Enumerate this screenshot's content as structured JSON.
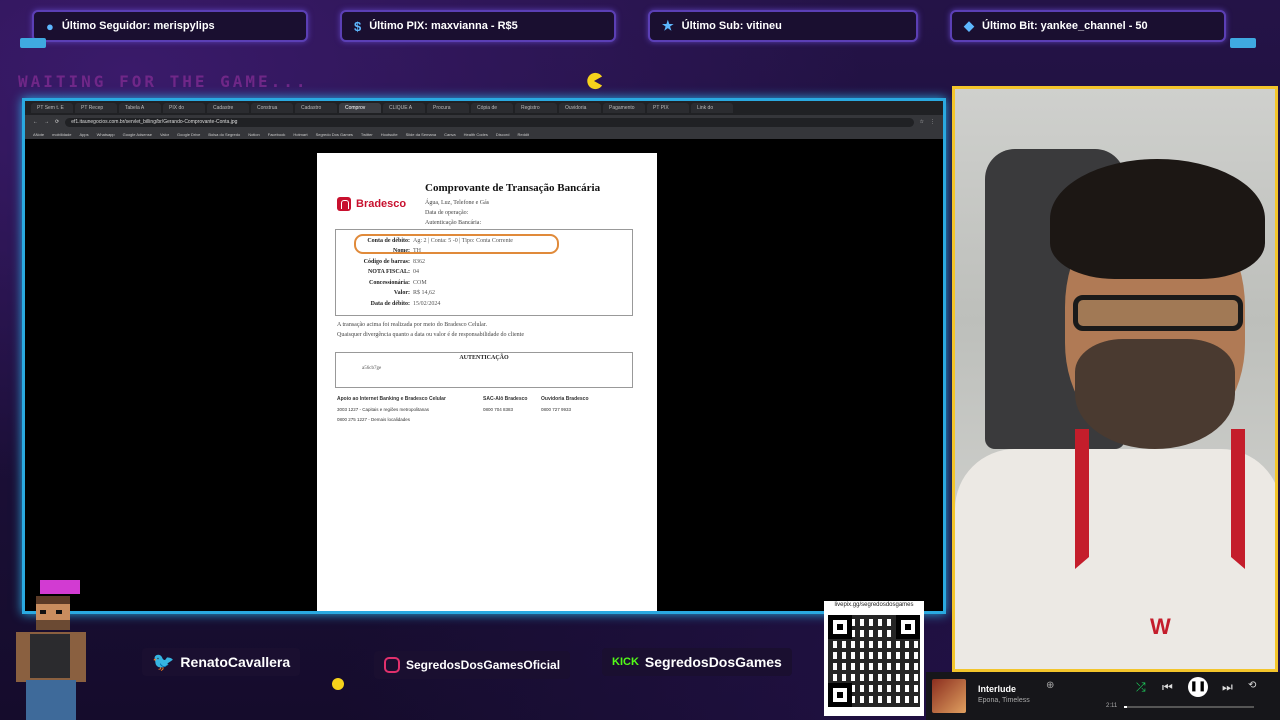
{
  "alerts": [
    {
      "icon": "user-icon",
      "text": "Último Seguidor: merispylips"
    },
    {
      "icon": "pix-icon",
      "text": "Último PIX: maxvianna - R$5"
    },
    {
      "icon": "star-icon",
      "text": "Último Sub: vitineu"
    },
    {
      "icon": "diamond-icon",
      "text": "Último Bit: yankee_channel - 50"
    }
  ],
  "waiting_text": "WAITING FOR THE GAME...",
  "browser": {
    "tabs": [
      "PT Sem t. E",
      "PT Recep",
      "Tabela A",
      "PIX do",
      "Cadastre",
      "Construa",
      "Cadastro",
      "Comprov",
      "CLIQUE A",
      "Procura",
      "Cópia de",
      "Registro",
      "Ouvidoria",
      "Pagamento",
      "PT PIX",
      "Link do"
    ],
    "url": "ef1.itaunegocios.com.br/servlet_billing/br/Gerando-Comprovante-Conta.jpg",
    "bookmarks": [
      "ANote",
      "mobilidade",
      "Apps",
      "Whatsapp",
      "Google Adsense",
      "Valor",
      "Google Drive",
      "Bolsa do Segredo",
      "Notion",
      "Facebook",
      "Hotmart",
      "Segredo Dos Games",
      "Twitter",
      "Hootsuite",
      "Slide da Semana",
      "Canva",
      "Health Codes",
      "Discord",
      "Reddit"
    ]
  },
  "document": {
    "bank": "Bradesco",
    "title": "Comprovante de Transação Bancária",
    "subtitle_lines": [
      "Água, Luz, Telefone e Gás",
      "Data de operação:",
      "Autenticação Bancária:"
    ],
    "fields": [
      {
        "label": "Conta de débito:",
        "value": "Ag: 2     | Conta: 5       -0 | Tipo: Conta Corrente"
      },
      {
        "label": "Nome:",
        "value": "TH"
      },
      {
        "label": "Código de barras:",
        "value": "8362"
      },
      {
        "label": "NOTA FISCAL:",
        "value": "04"
      },
      {
        "label": "Concessionária:",
        "value": "COM"
      },
      {
        "label": "Valor:",
        "value": "R$ 14,62"
      },
      {
        "label": "Data de débito:",
        "value": "15/02/2024"
      }
    ],
    "note_lines": [
      "A transação acima foi realizada por meio do Bradesco Celular.",
      "Quaisquer divergência quanto a data ou valor é de responsabilidade do cliente"
    ],
    "auth_title": "AUTENTICAÇÃO",
    "auth_value": "a56cb7ge",
    "footer": [
      {
        "title": "Apoio ao Internet Banking e Bradesco Celular",
        "lines": [
          "3003 1227 - Capitais e regiões metropolitanas",
          "0800 275 1227 - Demais localidades"
        ]
      },
      {
        "title": "SAC-Alô Bradesco",
        "lines": [
          "0800 704 8383"
        ]
      },
      {
        "title": "Ouvidoria Bradesco",
        "lines": [
          "0800 727 9933"
        ]
      }
    ]
  },
  "socials": [
    {
      "icon": "twitter-icon",
      "text": "RenatoCavallera"
    },
    {
      "icon": "instagram-icon",
      "text": "SegredosDosGamesOficial"
    },
    {
      "icon": "kick-icon",
      "badge": "KICK",
      "text": "SegredosDosGames"
    }
  ],
  "qr": {
    "url": "livepix.gg/segredosdosgames"
  },
  "player": {
    "track": "Interlude",
    "artist": "Epona, Timeless",
    "elapsed": "2:11",
    "progress": 0.02
  }
}
